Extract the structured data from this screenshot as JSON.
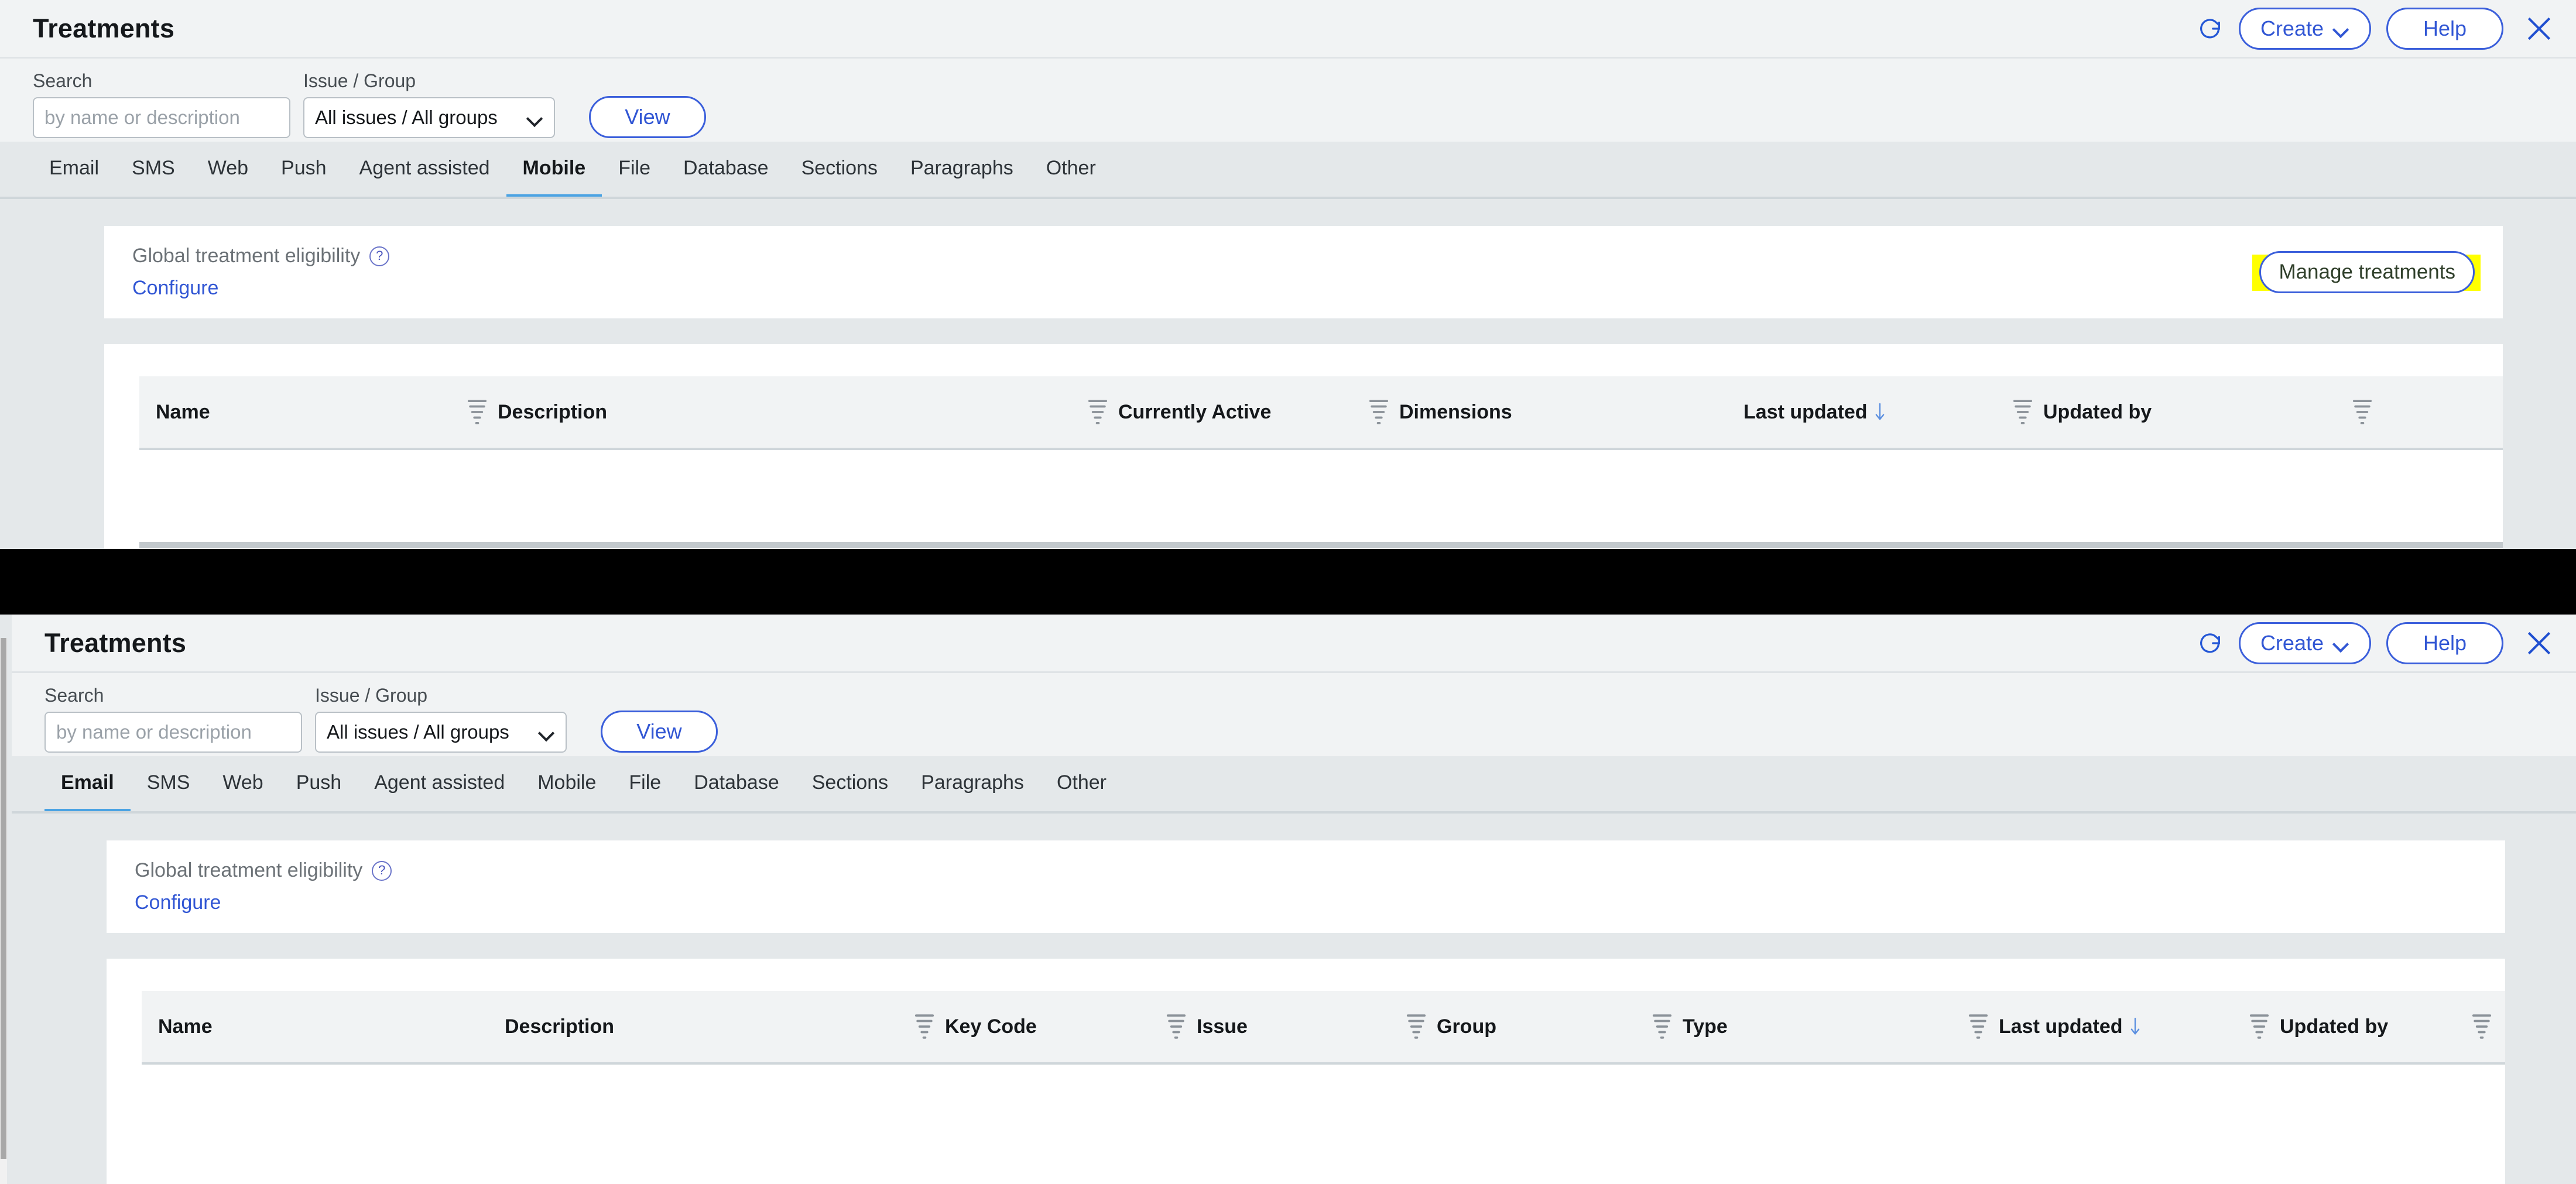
{
  "panels": [
    {
      "id": "top",
      "title": "Treatments",
      "titlebar": {
        "refresh_icon": "refresh-icon",
        "create_label": "Create",
        "create_caret_icon": "chevron-down-icon",
        "help_label": "Help",
        "close_icon": "close-icon"
      },
      "filterbar": {
        "search_label": "Search",
        "search_placeholder": "by name or description",
        "search_value": "",
        "issue_group_label": "Issue / Group",
        "issue_group_value": "All issues  /  All groups",
        "issue_group_caret_icon": "chevron-down-icon",
        "view_label": "View"
      },
      "tabs": [
        {
          "label": "Email",
          "active": false
        },
        {
          "label": "SMS",
          "active": false
        },
        {
          "label": "Web",
          "active": false
        },
        {
          "label": "Push",
          "active": false
        },
        {
          "label": "Agent assisted",
          "active": false
        },
        {
          "label": "Mobile",
          "active": true
        },
        {
          "label": "File",
          "active": false
        },
        {
          "label": "Database",
          "active": false
        },
        {
          "label": "Sections",
          "active": false
        },
        {
          "label": "Paragraphs",
          "active": false
        },
        {
          "label": "Other",
          "active": false
        }
      ],
      "eligibility": {
        "title": "Global treatment eligibility",
        "help_icon": "help-circle-icon",
        "configure_label": "Configure",
        "manage_label": "Manage treatments",
        "manage_highlighted": true,
        "highlight_color": "#ffff00"
      },
      "table": {
        "columns": [
          {
            "label": "Name",
            "filter": false,
            "sorted": false
          },
          {
            "label": "Description",
            "filter": true,
            "sorted": false
          },
          {
            "label": "Currently Active",
            "filter": true,
            "sorted": false
          },
          {
            "label": "Dimensions",
            "filter": true,
            "sorted": false
          },
          {
            "label": "Last updated",
            "filter": false,
            "sorted": true,
            "sort_dir": "desc"
          },
          {
            "label": "Updated by",
            "filter": true,
            "sorted": false
          },
          {
            "label": "",
            "filter": true,
            "sorted": false
          }
        ],
        "rows": []
      }
    },
    {
      "id": "bottom",
      "title": "Treatments",
      "titlebar": {
        "refresh_icon": "refresh-icon",
        "create_label": "Create",
        "create_caret_icon": "chevron-down-icon",
        "help_label": "Help",
        "close_icon": "close-icon"
      },
      "filterbar": {
        "search_label": "Search",
        "search_placeholder": "by name or description",
        "search_value": "",
        "issue_group_label": "Issue / Group",
        "issue_group_value": "All issues  /  All groups",
        "issue_group_caret_icon": "chevron-down-icon",
        "view_label": "View"
      },
      "tabs": [
        {
          "label": "Email",
          "active": true
        },
        {
          "label": "SMS",
          "active": false
        },
        {
          "label": "Web",
          "active": false
        },
        {
          "label": "Push",
          "active": false
        },
        {
          "label": "Agent assisted",
          "active": false
        },
        {
          "label": "Mobile",
          "active": false
        },
        {
          "label": "File",
          "active": false
        },
        {
          "label": "Database",
          "active": false
        },
        {
          "label": "Sections",
          "active": false
        },
        {
          "label": "Paragraphs",
          "active": false
        },
        {
          "label": "Other",
          "active": false
        }
      ],
      "eligibility": {
        "title": "Global treatment eligibility",
        "help_icon": "help-circle-icon",
        "configure_label": "Configure",
        "manage_label": "",
        "manage_highlighted": false,
        "highlight_color": "#ffff00"
      },
      "table": {
        "columns": [
          {
            "label": "Name",
            "filter": false,
            "sorted": false
          },
          {
            "label": "Description",
            "filter": false,
            "sorted": false
          },
          {
            "label": "Key Code",
            "filter": true,
            "sorted": false
          },
          {
            "label": "Issue",
            "filter": true,
            "sorted": false
          },
          {
            "label": "Group",
            "filter": true,
            "sorted": false
          },
          {
            "label": "Type",
            "filter": true,
            "sorted": false
          },
          {
            "label": "Last updated",
            "filter": true,
            "sorted": true,
            "sort_dir": "desc"
          },
          {
            "label": "Updated by",
            "filter": true,
            "sorted": false
          },
          {
            "label": "",
            "filter": true,
            "sorted": false
          }
        ],
        "rows": []
      }
    }
  ],
  "colors": {
    "page_bg": "#e4e8ea",
    "chrome_bg": "#f1f3f4",
    "card_bg": "#ffffff",
    "accent_blue": "#3156d4",
    "tab_active_underline": "#4ba3e3",
    "highlight_yellow": "#ffff00",
    "separator_band": "#000000",
    "muted_text": "#6b7176"
  }
}
